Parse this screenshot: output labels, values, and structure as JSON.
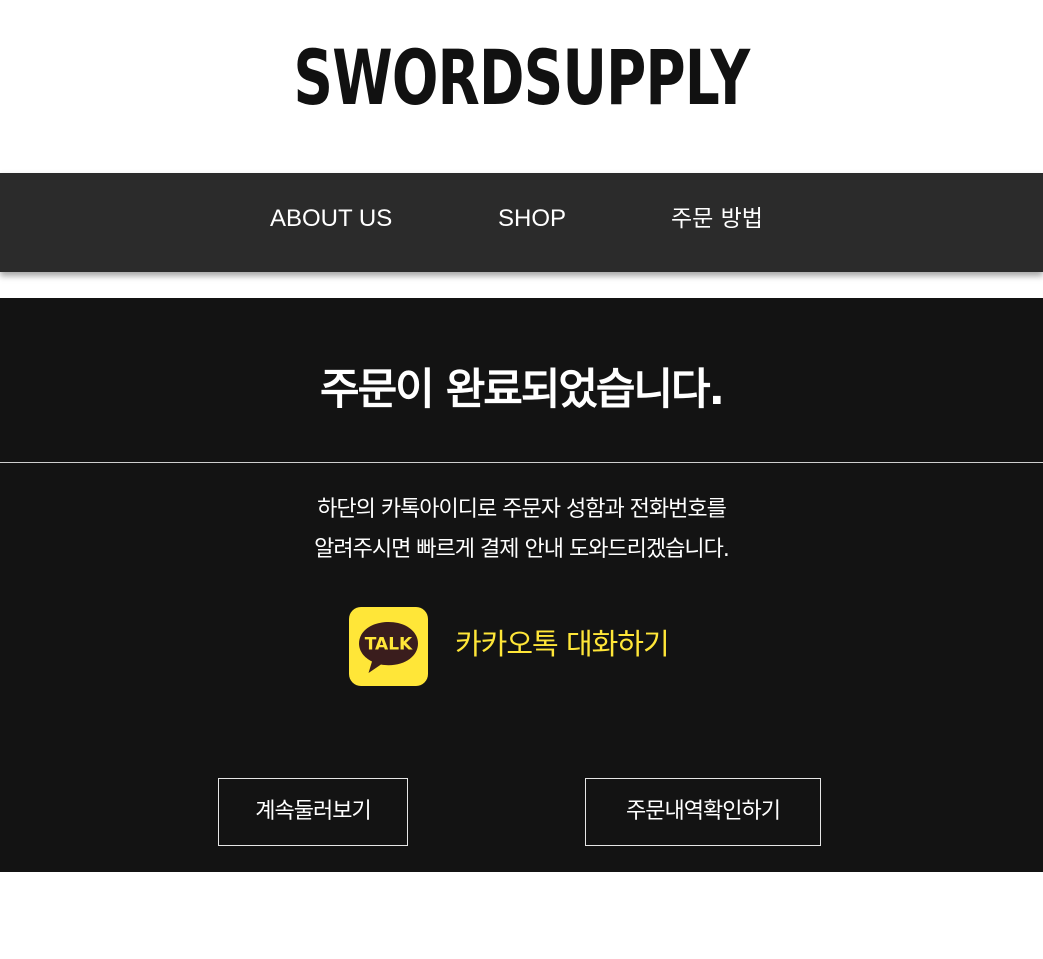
{
  "brand": {
    "logo": "SWORDSUPPLY"
  },
  "nav": {
    "items": [
      {
        "label": "ABOUT US"
      },
      {
        "label": "SHOP"
      },
      {
        "label": "주문 방법"
      }
    ]
  },
  "order_complete": {
    "title": "주문이 완료되었습니다.",
    "description_line1": "하단의 카톡아이디로 주문자 성함과 전화번호를",
    "description_line2": "알려주시면 빠르게 결제 안내 도와드리겠습니다.",
    "kakao": {
      "icon_text": "TALK",
      "label": "카카오톡 대화하기",
      "icon_name": "kakaotalk-icon"
    },
    "buttons": {
      "continue_label": "계속둘러보기",
      "history_label": "주문내역확인하기"
    }
  },
  "colors": {
    "nav_bg": "#2b2b2b",
    "main_bg": "#131313",
    "kakao_yellow": "#ffe638",
    "kakao_brown": "#3a1d1d"
  }
}
